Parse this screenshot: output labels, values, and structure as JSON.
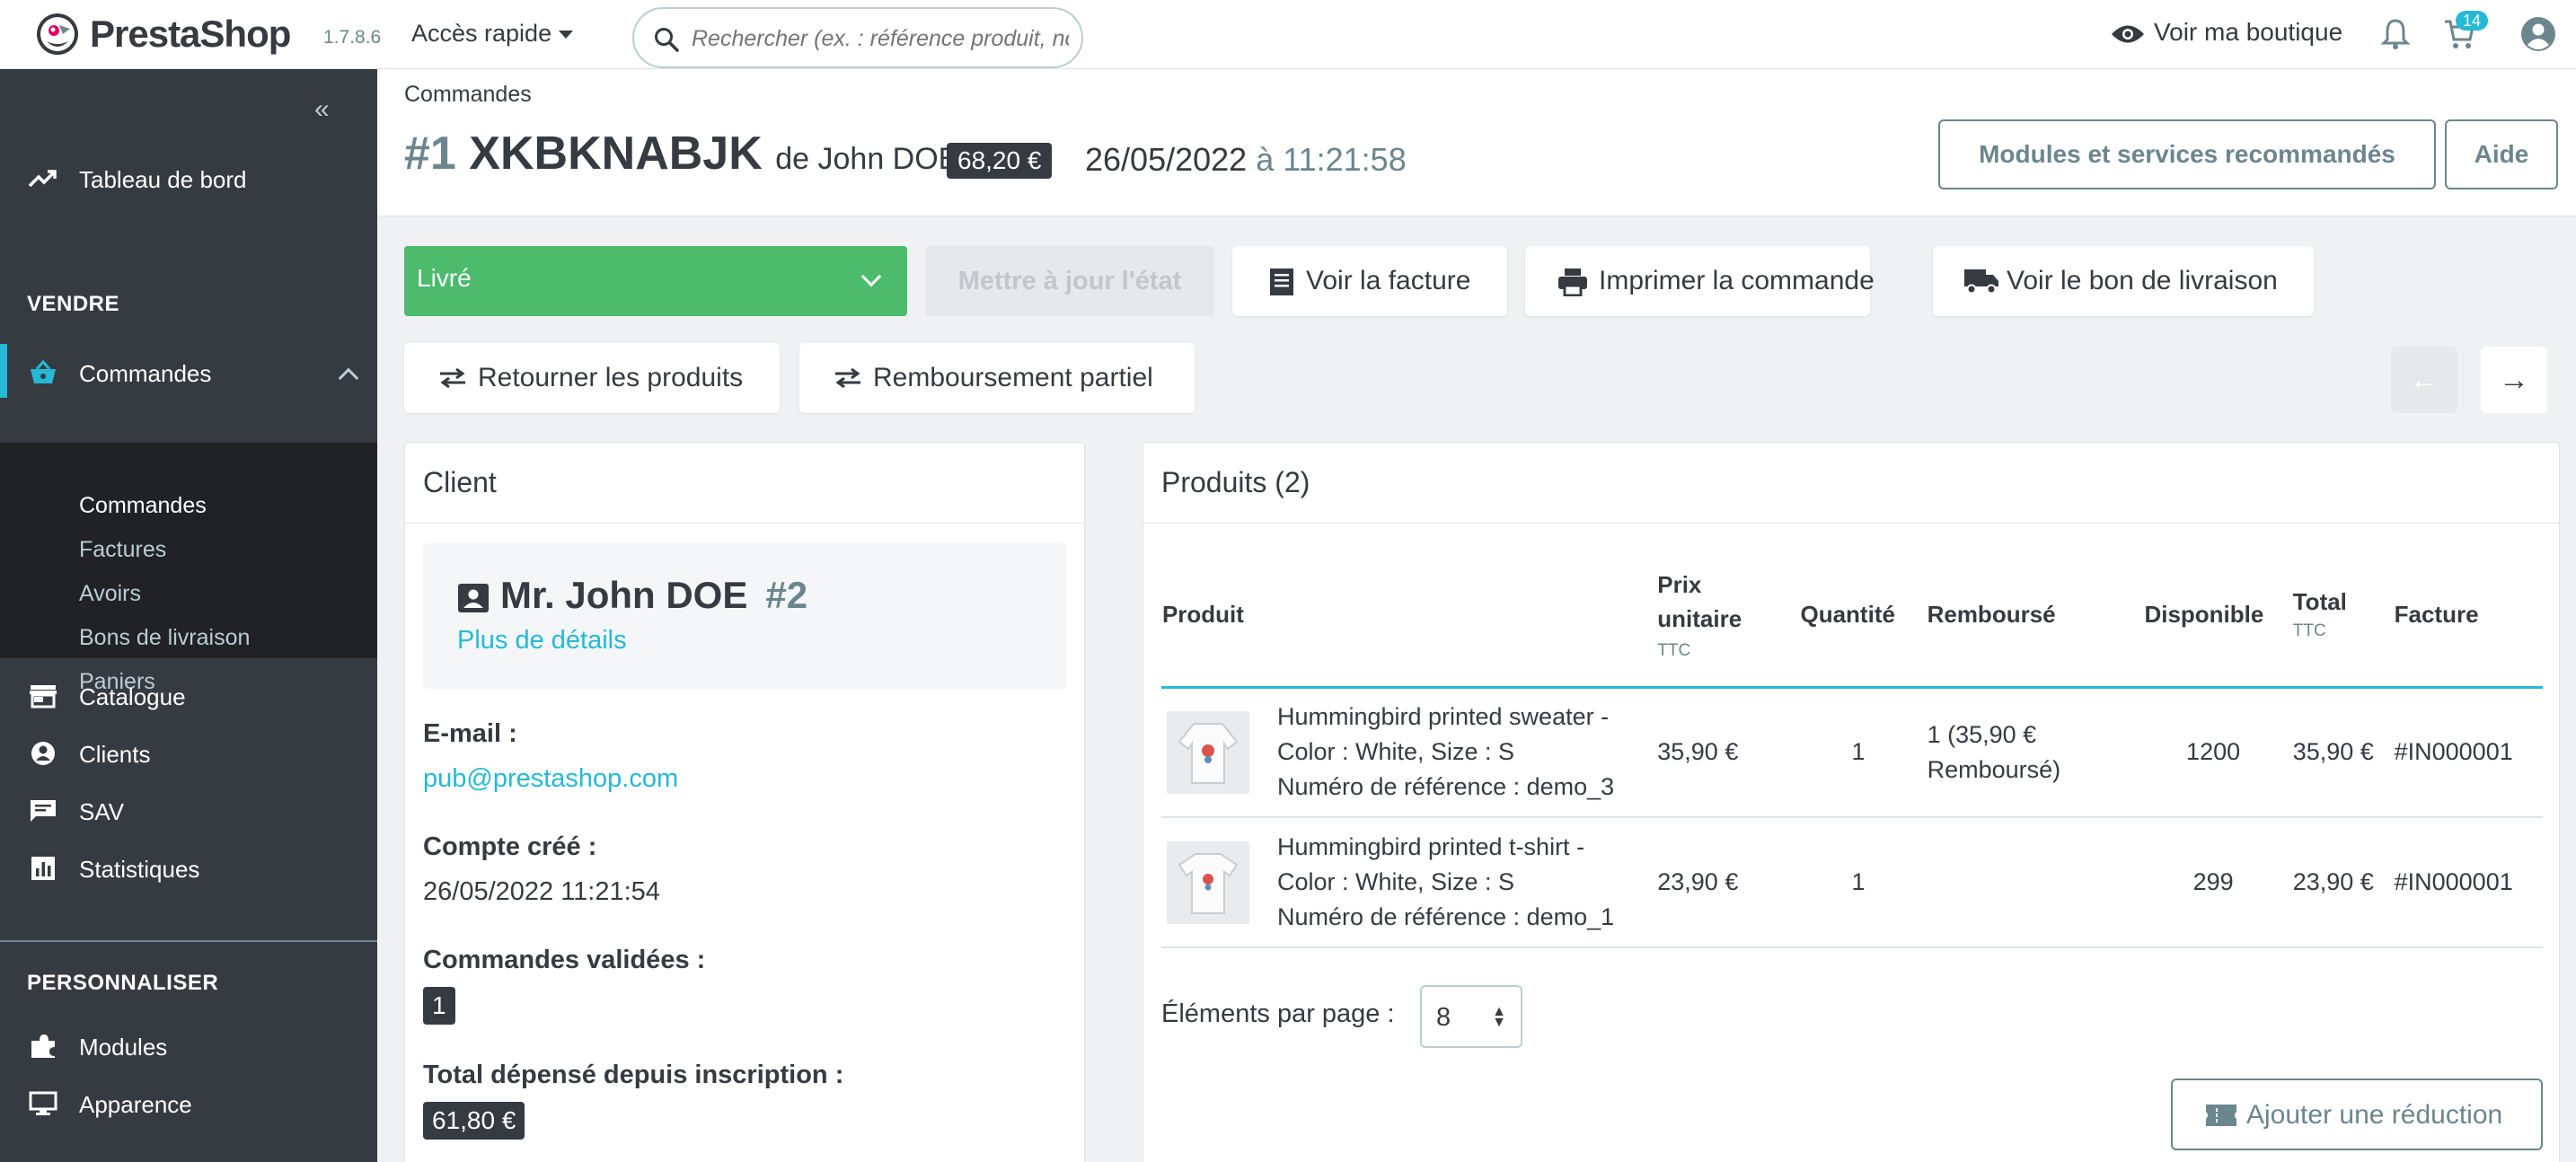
{
  "header": {
    "brand": "PrestaShop",
    "version": "1.7.8.6",
    "quick_access": "Accès rapide",
    "search_placeholder": "Rechercher (ex. : référence produit, no",
    "view_shop": "Voir ma boutique",
    "cart_badge": "14"
  },
  "sidebar": {
    "dashboard": "Tableau de bord",
    "section_sell": "VENDRE",
    "orders": "Commandes",
    "sub": [
      "Commandes",
      "Factures",
      "Avoirs",
      "Bons de livraison",
      "Paniers"
    ],
    "catalog": "Catalogue",
    "customers": "Clients",
    "sav": "SAV",
    "stats": "Statistiques",
    "section_custom": "PERSONNALISER",
    "modules": "Modules",
    "appearance": "Apparence"
  },
  "page": {
    "breadcrumb": "Commandes",
    "order_hash": "#1",
    "order_ref": "XKBKNABJK",
    "order_by": "de John DOE",
    "order_total": "68,20 €",
    "order_date": "26/05/2022",
    "order_at": "à",
    "order_time": "11:21:58",
    "btn_modules": "Modules et services recommandés",
    "btn_help": "Aide"
  },
  "actions": {
    "status": "Livré",
    "update_state": "Mettre à jour l'état",
    "view_invoice": "Voir la facture",
    "print_order": "Imprimer la commande",
    "view_delivery": "Voir le bon de livraison",
    "return_products": "Retourner les produits",
    "partial_refund": "Remboursement partiel",
    "prev_arrow": "←",
    "next_arrow": "→"
  },
  "client": {
    "panel_title": "Client",
    "name": "Mr. John DOE",
    "id": "#2",
    "more": "Plus de détails",
    "email_label": "E-mail :",
    "email": "pub@prestashop.com",
    "created_label": "Compte créé :",
    "created": "26/05/2022 11:21:54",
    "validated_label": "Commandes validées :",
    "validated": "1",
    "spent_label": "Total dépensé depuis inscription :",
    "spent": "61,80 €"
  },
  "products": {
    "panel_title": "Produits (2)",
    "col_product": "Produit",
    "col_unit": "Prix unitaire",
    "col_unit_sub": "TTC",
    "col_qty": "Quantité",
    "col_refunded": "Remboursé",
    "col_available": "Disponible",
    "col_total": "Total",
    "col_total_sub": "TTC",
    "col_invoice": "Facture",
    "rows": [
      {
        "line1": "Hummingbird printed sweater -",
        "line2": "Color : White, Size : S",
        "line3": "Numéro de référence : demo_3",
        "unit": "35,90 €",
        "qty": "1",
        "refunded1": "1 (35,90 €",
        "refunded2": "Remboursé)",
        "available": "1200",
        "total": "35,90 €",
        "invoice": "#IN000001"
      },
      {
        "line1": "Hummingbird printed t-shirt -",
        "line2": "Color : White, Size : S",
        "line3": "Numéro de référence : demo_1",
        "unit": "23,90 €",
        "qty": "1",
        "refunded1": "",
        "refunded2": "",
        "available": "299",
        "total": "23,90 €",
        "invoice": "#IN000001"
      }
    ],
    "per_page_label": "Éléments par page :",
    "per_page": "8",
    "add_discount": "Ajouter une réduction"
  },
  "colors": {
    "accent": "#25b9d7",
    "status_green": "#4cbb6c",
    "sidebar": "#363a41"
  }
}
